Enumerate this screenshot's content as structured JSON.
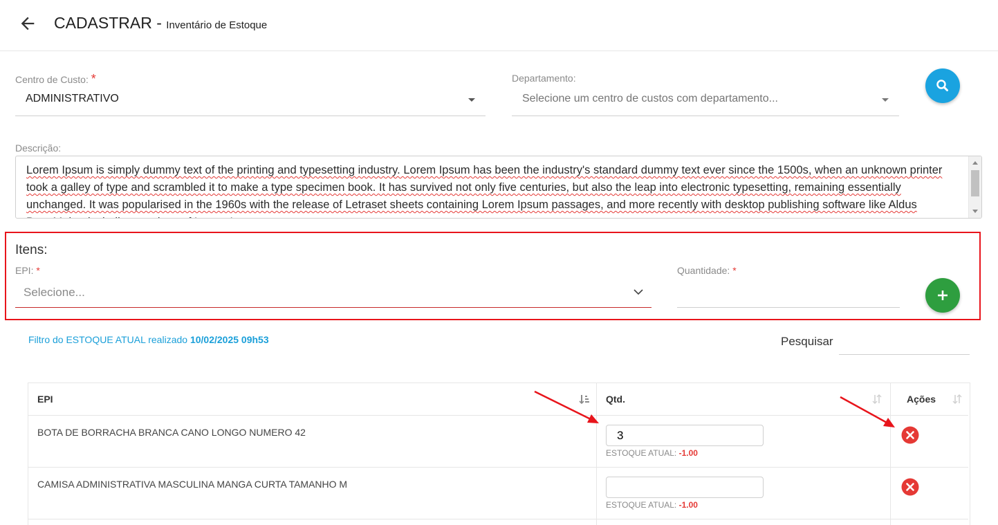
{
  "header": {
    "title": "CADASTRAR -",
    "subtitle": "Inventário de Estoque"
  },
  "form": {
    "centro_custo": {
      "label": "Centro de Custo:",
      "required": "*",
      "value": "ADMINISTRATIVO"
    },
    "departamento": {
      "label": "Departamento:",
      "placeholder": "Selecione um centro de custos com departamento..."
    },
    "descricao": {
      "label": "Descrição:",
      "value": "Lorem Ipsum is simply dummy text of the printing and typesetting industry. Lorem Ipsum has been the industry's standard dummy text ever since the 1500s, when an unknown printer took a galley of type and scrambled it to make a type specimen book. It has survived not only five centuries, but also the leap into electronic typesetting, remaining essentially unchanged. It was popularised in the 1960s with the release of Letraset sheets containing Lorem Ipsum passages, and more recently with desktop publishing software like Aldus PageMaker including versions of Lorem Ipsum."
    }
  },
  "itens": {
    "heading": "Itens:",
    "epi_label": "EPI:",
    "epi_required": "*",
    "epi_placeholder": "Selecione...",
    "quantidade_label": "Quantidade:",
    "quantidade_required": "*"
  },
  "filter": {
    "text": "Filtro do ESTOQUE ATUAL realizado",
    "datetime": "10/02/2025 09h53"
  },
  "search": {
    "label": "Pesquisar"
  },
  "table": {
    "columns": [
      "EPI",
      "Qtd.",
      "Ações"
    ],
    "stock_label": "ESTOQUE ATUAL:",
    "rows": [
      {
        "epi": "BOTA DE BORRACHA BRANCA CANO LONGO NUMERO 42",
        "qtd": "3",
        "stock": "-1.00"
      },
      {
        "epi": "CAMISA ADMINISTRATIVA MASCULINA MANGA CURTA TAMANHO M",
        "qtd": "",
        "stock": "-1.00"
      }
    ]
  },
  "colors": {
    "search_button": "#1aa3e0",
    "add_button": "#2e9e3f",
    "delete_button": "#e53935",
    "highlight_border": "#e8141b",
    "link_blue": "#1a9fd9"
  },
  "icons": {
    "back": "arrow-left-icon",
    "search": "search-icon",
    "add": "plus-icon",
    "delete": "close-circle-icon",
    "dropdown": "chevron-down-icon",
    "sort": "sort-icon"
  }
}
